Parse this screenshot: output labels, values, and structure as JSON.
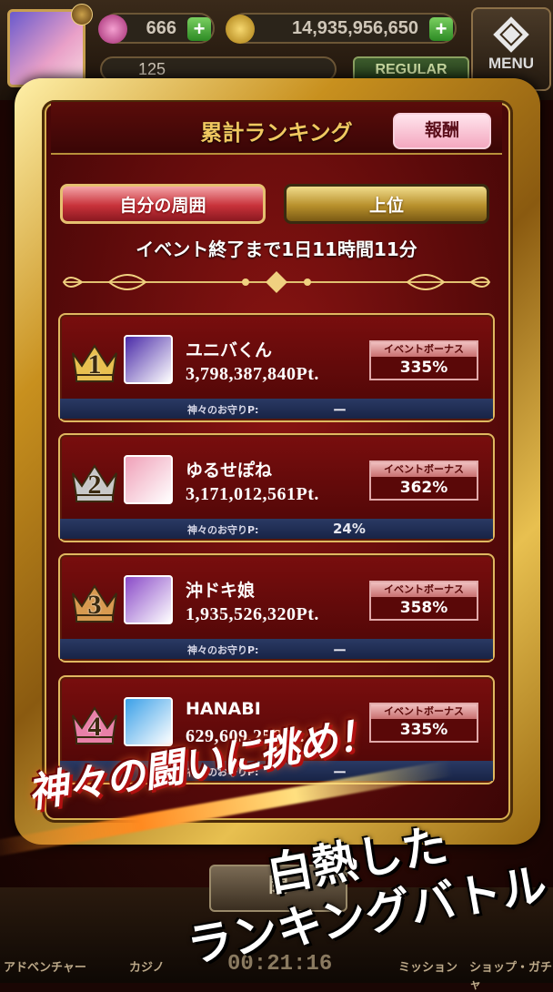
{
  "header": {
    "gems": "666",
    "coins": "14,935,956,650",
    "level": "125",
    "mode": "REGULAR",
    "menu_label": "MENU"
  },
  "panel": {
    "title": "累計ランキング",
    "reward_button": "報酬",
    "tabs": [
      "自分の周囲",
      "上位"
    ],
    "countdown": "イベント終了まで1日11時間11分"
  },
  "rankings": [
    {
      "rank": "1",
      "name": "ユニバくん",
      "points": "3,798,387,840Pt.",
      "bonus_label": "イベントボーナス",
      "bonus": "335%",
      "omamori_label": "神々のお守りP:",
      "omamori": "ー",
      "crown_color": "#e8c050",
      "icon_bg": "#4a2aa8"
    },
    {
      "rank": "2",
      "name": "ゆるせぽね",
      "points": "3,171,012,561Pt.",
      "bonus_label": "イベントボーナス",
      "bonus": "362%",
      "omamori_label": "神々のお守りP:",
      "omamori": "24%",
      "crown_color": "#c8c8c8",
      "icon_bg": "#f0a0b8"
    },
    {
      "rank": "3",
      "name": "沖ドキ娘",
      "points": "1,935,526,320Pt.",
      "bonus_label": "イベントボーナス",
      "bonus": "358%",
      "omamori_label": "神々のお守りP:",
      "omamori": "ー",
      "crown_color": "#d89a50",
      "icon_bg": "#8a4ac8"
    },
    {
      "rank": "4",
      "name": "HANABI",
      "points": "629,609,256Pt.",
      "bonus_label": "イベントボーナス",
      "bonus": "335%",
      "omamori_label": "神々のお守りP:",
      "omamori": "ー",
      "crown_color": "#e880a8",
      "icon_bg": "#3aa0e8"
    }
  ],
  "promo": {
    "line1": "神々の闘いに挑め！",
    "line2": "白熱した",
    "line3": "ランキングバトル"
  },
  "bottom": {
    "close_label": "閉",
    "timer": "00:21:16",
    "nav": [
      "アドベンチャー",
      "カジノ",
      "ミッション",
      "ショップ・ガチャ"
    ]
  }
}
